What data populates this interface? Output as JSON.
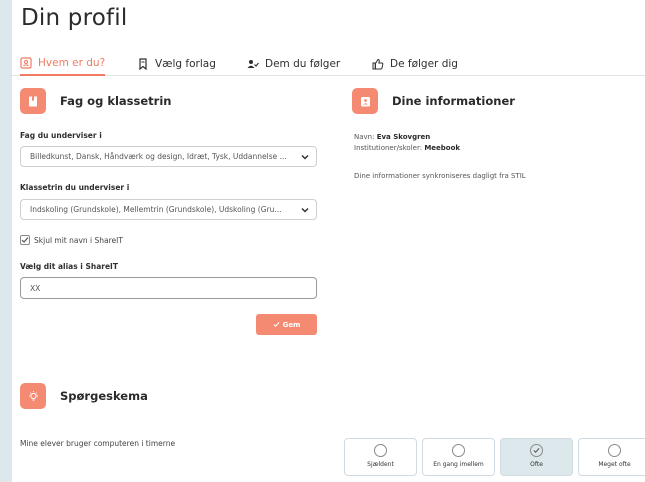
{
  "page": {
    "title": "Din profil"
  },
  "tabs": [
    {
      "label": "Hvem er du?",
      "icon": "id-card-icon",
      "active": true
    },
    {
      "label": "Vælg forlag",
      "icon": "bookmark-icon",
      "active": false
    },
    {
      "label": "Dem du følger",
      "icon": "user-check-icon",
      "active": false
    },
    {
      "label": "De følger dig",
      "icon": "thumbs-up-icon",
      "active": false
    }
  ],
  "subjects": {
    "heading": "Fag og klassetrin",
    "subject_label": "Fag du underviser i",
    "subject_value": "Billedkunst, Dansk, Håndværk og design, Idræt, Tysk, Uddannelse ...",
    "grade_label": "Klassetrin du underviser i",
    "grade_value": "Indskoling (Grundskole), Mellemtrin (Grundskole), Udskoling (Gru...",
    "hide_name_label": "Skjul mit navn i ShareIT",
    "hide_name_checked": true,
    "alias_label": "Vælg dit alias i ShareIT",
    "alias_value": "XX",
    "save_label": "Gem"
  },
  "info": {
    "heading": "Dine informationer",
    "name_label": "Navn:",
    "name_value": "Eva Skovgren",
    "school_label": "Institutioner/skoler:",
    "school_value": "Meebook",
    "sync_note": "Dine informationer synkroniseres dagligt fra STIL"
  },
  "survey": {
    "heading": "Spørgeskema",
    "question": "Mine elever bruger computeren i timerne",
    "options": [
      {
        "label": "Sjældent",
        "selected": false
      },
      {
        "label": "En gang imellem",
        "selected": false
      },
      {
        "label": "Ofte",
        "selected": true
      },
      {
        "label": "Meget ofte",
        "selected": false
      }
    ]
  },
  "colors": {
    "accent": "#f07a62",
    "badge": "#f58a73",
    "background": "#dde8ee",
    "selected_option": "#dde8ec"
  }
}
